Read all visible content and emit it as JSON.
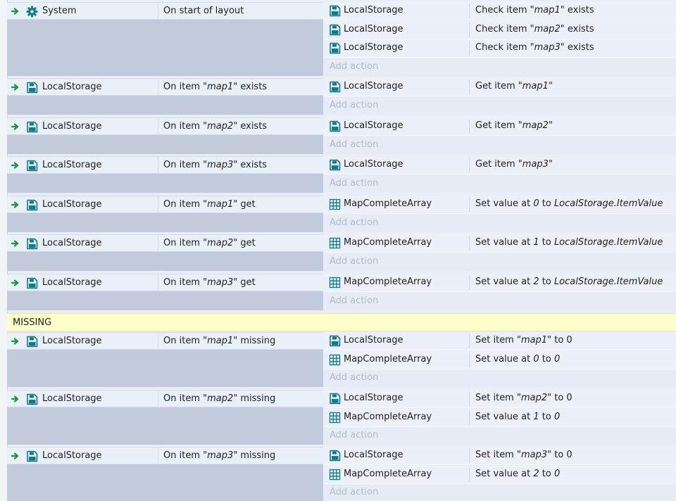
{
  "add_action_label": "Add action",
  "comment_text": "MISSING",
  "icons": {
    "trigger": "green-arrow-icon",
    "system": "gear-icon",
    "localstorage": "local-storage-icon",
    "array": "grid-array-icon"
  },
  "colors": {
    "trigger_arrow": "#1a9632",
    "icon_teal": "#0e7a8c",
    "comment_bg": "#ffffcc",
    "add_action_text": "#b3bccc"
  },
  "events": [
    {
      "id": "start",
      "condition": {
        "object": "System",
        "icon": "system",
        "parts": [
          {
            "t": "On start of layout"
          }
        ]
      },
      "actions": [
        {
          "object": "LocalStorage",
          "icon": "localstorage",
          "parts": [
            {
              "t": "Check item \""
            },
            {
              "t": "map1",
              "i": true
            },
            {
              "t": "\" exists"
            }
          ]
        },
        {
          "object": "LocalStorage",
          "icon": "localstorage",
          "parts": [
            {
              "t": "Check item \""
            },
            {
              "t": "map2",
              "i": true
            },
            {
              "t": "\" exists"
            }
          ]
        },
        {
          "object": "LocalStorage",
          "icon": "localstorage",
          "parts": [
            {
              "t": "Check item \""
            },
            {
              "t": "map3",
              "i": true
            },
            {
              "t": "\" exists"
            }
          ]
        }
      ]
    },
    {
      "id": "exists-map1",
      "condition": {
        "object": "LocalStorage",
        "icon": "localstorage",
        "parts": [
          {
            "t": "On item \""
          },
          {
            "t": "map1",
            "i": true
          },
          {
            "t": "\"  exists"
          }
        ]
      },
      "actions": [
        {
          "object": "LocalStorage",
          "icon": "localstorage",
          "parts": [
            {
              "t": "Get item \""
            },
            {
              "t": "map1",
              "i": true
            },
            {
              "t": "\""
            }
          ]
        }
      ]
    },
    {
      "id": "exists-map2",
      "condition": {
        "object": "LocalStorage",
        "icon": "localstorage",
        "parts": [
          {
            "t": "On item \""
          },
          {
            "t": "map2",
            "i": true
          },
          {
            "t": "\"  exists"
          }
        ]
      },
      "actions": [
        {
          "object": "LocalStorage",
          "icon": "localstorage",
          "parts": [
            {
              "t": "Get item \""
            },
            {
              "t": "map2",
              "i": true
            },
            {
              "t": "\""
            }
          ]
        }
      ]
    },
    {
      "id": "exists-map3",
      "condition": {
        "object": "LocalStorage",
        "icon": "localstorage",
        "parts": [
          {
            "t": "On item \""
          },
          {
            "t": "map3",
            "i": true
          },
          {
            "t": "\"  exists"
          }
        ]
      },
      "actions": [
        {
          "object": "LocalStorage",
          "icon": "localstorage",
          "parts": [
            {
              "t": "Get item \""
            },
            {
              "t": "map3",
              "i": true
            },
            {
              "t": "\""
            }
          ]
        }
      ]
    },
    {
      "id": "get-map1",
      "condition": {
        "object": "LocalStorage",
        "icon": "localstorage",
        "parts": [
          {
            "t": "On item \""
          },
          {
            "t": "map1",
            "i": true
          },
          {
            "t": "\" get"
          }
        ]
      },
      "actions": [
        {
          "object": "MapCompleteArray",
          "icon": "array",
          "parts": [
            {
              "t": "Set value at "
            },
            {
              "t": "0",
              "i": true
            },
            {
              "t": " to "
            },
            {
              "t": "LocalStorage.ItemValue",
              "i": true
            }
          ]
        }
      ]
    },
    {
      "id": "get-map2",
      "condition": {
        "object": "LocalStorage",
        "icon": "localstorage",
        "parts": [
          {
            "t": "On item \""
          },
          {
            "t": "map2",
            "i": true
          },
          {
            "t": "\" get"
          }
        ]
      },
      "actions": [
        {
          "object": "MapCompleteArray",
          "icon": "array",
          "parts": [
            {
              "t": "Set value at "
            },
            {
              "t": "1",
              "i": true
            },
            {
              "t": " to "
            },
            {
              "t": "LocalStorage.ItemValue",
              "i": true
            }
          ]
        }
      ]
    },
    {
      "id": "get-map3",
      "condition": {
        "object": "LocalStorage",
        "icon": "localstorage",
        "parts": [
          {
            "t": "On item \""
          },
          {
            "t": "map3",
            "i": true
          },
          {
            "t": "\" get"
          }
        ]
      },
      "actions": [
        {
          "object": "MapCompleteArray",
          "icon": "array",
          "parts": [
            {
              "t": "Set value at "
            },
            {
              "t": "2",
              "i": true
            },
            {
              "t": " to "
            },
            {
              "t": "LocalStorage.ItemValue",
              "i": true
            }
          ]
        }
      ]
    },
    {
      "id": "missing-map1",
      "condition": {
        "object": "LocalStorage",
        "icon": "localstorage",
        "parts": [
          {
            "t": "On item \""
          },
          {
            "t": "map1",
            "i": true
          },
          {
            "t": "\" missing"
          }
        ]
      },
      "actions": [
        {
          "object": "LocalStorage",
          "icon": "localstorage",
          "parts": [
            {
              "t": "Set item \""
            },
            {
              "t": "map1",
              "i": true
            },
            {
              "t": "\" to 0"
            }
          ]
        },
        {
          "object": "MapCompleteArray",
          "icon": "array",
          "parts": [
            {
              "t": "Set value at "
            },
            {
              "t": "0",
              "i": true
            },
            {
              "t": " to "
            },
            {
              "t": "0",
              "i": true
            }
          ]
        }
      ]
    },
    {
      "id": "missing-map2",
      "condition": {
        "object": "LocalStorage",
        "icon": "localstorage",
        "parts": [
          {
            "t": "On item \""
          },
          {
            "t": "map2",
            "i": true
          },
          {
            "t": "\" missing"
          }
        ]
      },
      "actions": [
        {
          "object": "LocalStorage",
          "icon": "localstorage",
          "parts": [
            {
              "t": "Set item \""
            },
            {
              "t": "map2",
              "i": true
            },
            {
              "t": "\" to 0"
            }
          ]
        },
        {
          "object": "MapCompleteArray",
          "icon": "array",
          "parts": [
            {
              "t": "Set value at "
            },
            {
              "t": "1",
              "i": true
            },
            {
              "t": " to "
            },
            {
              "t": "0",
              "i": true
            }
          ]
        }
      ]
    },
    {
      "id": "missing-map3",
      "condition": {
        "object": "LocalStorage",
        "icon": "localstorage",
        "parts": [
          {
            "t": "On item \""
          },
          {
            "t": "map3",
            "i": true
          },
          {
            "t": "\" missing"
          }
        ]
      },
      "actions": [
        {
          "object": "LocalStorage",
          "icon": "localstorage",
          "parts": [
            {
              "t": "Set item \""
            },
            {
              "t": "map3",
              "i": true
            },
            {
              "t": "\" to 0"
            }
          ]
        },
        {
          "object": "MapCompleteArray",
          "icon": "array",
          "parts": [
            {
              "t": "Set value at "
            },
            {
              "t": "2",
              "i": true
            },
            {
              "t": " to "
            },
            {
              "t": "0",
              "i": true
            }
          ]
        }
      ]
    }
  ]
}
